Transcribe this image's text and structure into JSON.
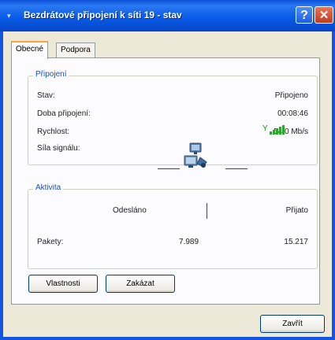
{
  "window": {
    "title": "Bezdrátové připojení k síti 19 - stav"
  },
  "tabs": [
    {
      "label": "Obecné"
    },
    {
      "label": "Podpora"
    }
  ],
  "connection": {
    "legend": "Připojení",
    "rows": [
      {
        "label": "Stav:",
        "value": "Připojeno"
      },
      {
        "label": "Doba připojení:",
        "value": "00:08:46"
      },
      {
        "label": "Rychlost:",
        "value": "54,0 Mb/s"
      },
      {
        "label": "Síla signálu:",
        "value": ""
      }
    ],
    "signal_strength_bars": 5,
    "signal_color": "#2ea52e"
  },
  "activity": {
    "legend": "Aktivita",
    "sent_label": "Odesláno",
    "received_label": "Přijato",
    "packets_label": "Pakety:",
    "packets_sent": "7.989",
    "packets_received": "15.217",
    "icon": "network-computers-icon"
  },
  "buttons": {
    "properties": "Vlastnosti",
    "disable": "Zakázat",
    "close": "Zavřít"
  },
  "colors": {
    "titlebar": "#0a5ce8",
    "legend_text": "#1f4fb4",
    "group_border": "#d0d0bf"
  }
}
